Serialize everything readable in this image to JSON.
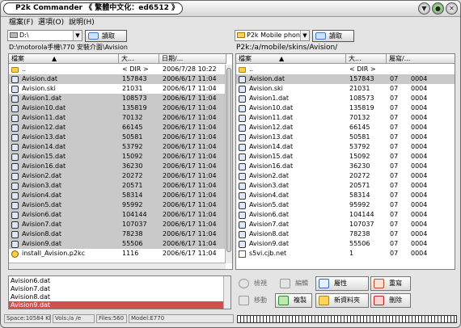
{
  "window": {
    "title": "P2k Commander 《 繁體中文化：ed6512 》",
    "buttons": [
      "▼",
      "●",
      "✕"
    ]
  },
  "menu": [
    "檔案(F)",
    "選項(O)",
    "說明(H)"
  ],
  "left": {
    "drive": "D:\\",
    "read_label": "讀取",
    "path": "D:\\motorola手機\\770 安裝介面\\Avision",
    "columns": [
      "檔案",
      "大...",
      "日期/..."
    ],
    "rows": [
      {
        "name": "..",
        "size": "< DIR >",
        "date": "2006/7/28 10:22",
        "icon": "folder",
        "sel": false
      },
      {
        "name": "Avision.dat",
        "size": "157843",
        "date": "2006/6/17 11:04",
        "icon": "file",
        "sel": true
      },
      {
        "name": "Avision.ski",
        "size": "21031",
        "date": "2006/6/17 11:04",
        "icon": "file",
        "sel": false
      },
      {
        "name": "Avision1.dat",
        "size": "108573",
        "date": "2006/6/17 11:04",
        "icon": "file",
        "sel": true
      },
      {
        "name": "Avision10.dat",
        "size": "135819",
        "date": "2006/6/17 11:04",
        "icon": "file",
        "sel": true
      },
      {
        "name": "Avision11.dat",
        "size": "70132",
        "date": "2006/6/17 11:04",
        "icon": "file",
        "sel": true
      },
      {
        "name": "Avision12.dat",
        "size": "66145",
        "date": "2006/6/17 11:04",
        "icon": "file",
        "sel": true
      },
      {
        "name": "Avision13.dat",
        "size": "50581",
        "date": "2006/6/17 11:04",
        "icon": "file",
        "sel": true
      },
      {
        "name": "Avision14.dat",
        "size": "53792",
        "date": "2006/6/17 11:04",
        "icon": "file",
        "sel": true
      },
      {
        "name": "Avision15.dat",
        "size": "15092",
        "date": "2006/6/17 11:04",
        "icon": "file",
        "sel": true
      },
      {
        "name": "Avision16.dat",
        "size": "36230",
        "date": "2006/6/17 11:04",
        "icon": "file",
        "sel": true
      },
      {
        "name": "Avision2.dat",
        "size": "20272",
        "date": "2006/6/17 11:04",
        "icon": "file",
        "sel": true
      },
      {
        "name": "Avision3.dat",
        "size": "20571",
        "date": "2006/6/17 11:04",
        "icon": "file",
        "sel": true
      },
      {
        "name": "Avision4.dat",
        "size": "58314",
        "date": "2006/6/17 11:04",
        "icon": "file",
        "sel": true
      },
      {
        "name": "Avision5.dat",
        "size": "95992",
        "date": "2006/6/17 11:04",
        "icon": "file",
        "sel": true
      },
      {
        "name": "Avision6.dat",
        "size": "104144",
        "date": "2006/6/17 11:04",
        "icon": "file",
        "sel": true
      },
      {
        "name": "Avision7.dat",
        "size": "107037",
        "date": "2006/6/17 11:04",
        "icon": "file",
        "sel": true
      },
      {
        "name": "Avision8.dat",
        "size": "78238",
        "date": "2006/6/17 11:04",
        "icon": "file",
        "sel": true
      },
      {
        "name": "Avision9.dat",
        "size": "55506",
        "date": "2006/6/17 11:04",
        "icon": "file",
        "sel": true
      },
      {
        "name": "install_Avision.p2kc",
        "size": "1116",
        "date": "2006/6/17 11:04",
        "icon": "pkg",
        "sel": false
      }
    ]
  },
  "right": {
    "drive": "P2k Mobile phone",
    "read_label": "讀取",
    "path": "P2k:/a/mobile/skins/Avision/",
    "columns": [
      "檔案",
      "大...",
      "屬寫/..."
    ],
    "rows": [
      {
        "name": "..",
        "size": "< DIR >",
        "attr": "",
        "id": "",
        "icon": "folder",
        "sel": false
      },
      {
        "name": "Avision.dat",
        "size": "157843",
        "attr": "07",
        "id": "0004",
        "icon": "file",
        "sel": true
      },
      {
        "name": "Avision.ski",
        "size": "21031",
        "attr": "07",
        "id": "0004",
        "icon": "file",
        "sel": false
      },
      {
        "name": "Avision1.dat",
        "size": "108573",
        "attr": "07",
        "id": "0004",
        "icon": "file",
        "sel": false
      },
      {
        "name": "Avision10.dat",
        "size": "135819",
        "attr": "07",
        "id": "0004",
        "icon": "file",
        "sel": false
      },
      {
        "name": "Avision11.dat",
        "size": "70132",
        "attr": "07",
        "id": "0004",
        "icon": "file",
        "sel": false
      },
      {
        "name": "Avision12.dat",
        "size": "66145",
        "attr": "07",
        "id": "0004",
        "icon": "file",
        "sel": false
      },
      {
        "name": "Avision13.dat",
        "size": "50581",
        "attr": "07",
        "id": "0004",
        "icon": "file",
        "sel": false
      },
      {
        "name": "Avision14.dat",
        "size": "53792",
        "attr": "07",
        "id": "0004",
        "icon": "file",
        "sel": false
      },
      {
        "name": "Avision15.dat",
        "size": "15092",
        "attr": "07",
        "id": "0004",
        "icon": "file",
        "sel": false
      },
      {
        "name": "Avision16.dat",
        "size": "36230",
        "attr": "07",
        "id": "0004",
        "icon": "file",
        "sel": false
      },
      {
        "name": "Avision2.dat",
        "size": "20272",
        "attr": "07",
        "id": "0004",
        "icon": "file",
        "sel": false
      },
      {
        "name": "Avision3.dat",
        "size": "20571",
        "attr": "07",
        "id": "0004",
        "icon": "file",
        "sel": false
      },
      {
        "name": "Avision4.dat",
        "size": "58314",
        "attr": "07",
        "id": "0004",
        "icon": "file",
        "sel": false
      },
      {
        "name": "Avision5.dat",
        "size": "95992",
        "attr": "07",
        "id": "0004",
        "icon": "file",
        "sel": false
      },
      {
        "name": "Avision6.dat",
        "size": "104144",
        "attr": "07",
        "id": "0004",
        "icon": "file",
        "sel": false
      },
      {
        "name": "Avision7.dat",
        "size": "107037",
        "attr": "07",
        "id": "0004",
        "icon": "file",
        "sel": false
      },
      {
        "name": "Avision8.dat",
        "size": "78238",
        "attr": "07",
        "id": "0004",
        "icon": "file",
        "sel": false
      },
      {
        "name": "Avision9.dat",
        "size": "55506",
        "attr": "07",
        "id": "0004",
        "icon": "file",
        "sel": false
      },
      {
        "name": "s5vi.cjb.net",
        "size": "1",
        "attr": "07",
        "id": "0004",
        "icon": "net",
        "sel": false
      }
    ]
  },
  "selected_files": [
    {
      "name": "Avision6.dat",
      "hl": false
    },
    {
      "name": "Avision7.dat",
      "hl": false
    },
    {
      "name": "Avision8.dat",
      "hl": false
    },
    {
      "name": "Avision9.dat",
      "hl": true
    }
  ],
  "actions": {
    "search": "檢視",
    "edit": "編輯",
    "props": "屬性",
    "rename": "重寫",
    "move": "移動",
    "copy": "複製",
    "newfolder": "新資料夾",
    "delete": "刪除"
  },
  "status": {
    "space": "Space:10584 Kb",
    "vols": "Vols:/a /e",
    "files": "Files:560",
    "model": "Model:E770"
  },
  "colors": {
    "selection_row": "#c9c9c9",
    "list_highlight": "#d05050"
  }
}
